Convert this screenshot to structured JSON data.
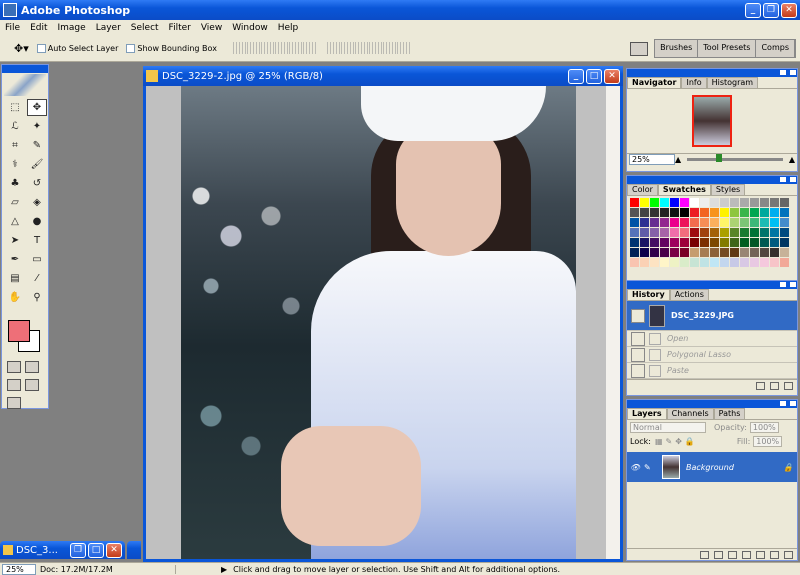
{
  "app": {
    "title": "Adobe Photoshop"
  },
  "menu": [
    "File",
    "Edit",
    "Image",
    "Layer",
    "Select",
    "Filter",
    "View",
    "Window",
    "Help"
  ],
  "options": {
    "auto_select": "Auto Select Layer",
    "bounding_box": "Show Bounding Box"
  },
  "wells": [
    "Brushes",
    "Tool Presets",
    "Comps"
  ],
  "document": {
    "title": "DSC_3229-2.jpg @ 25% (RGB/8)"
  },
  "navigator": {
    "tabs": [
      "Navigator",
      "Info",
      "Histogram"
    ],
    "zoom": "25%"
  },
  "color_panel": {
    "tabs": [
      "Color",
      "Swatches",
      "Styles"
    ]
  },
  "history": {
    "tabs": [
      "History",
      "Actions"
    ],
    "snapshot": "DSC_3229.JPG",
    "states": [
      "Open",
      "Polygonal Lasso",
      "Paste"
    ]
  },
  "layers": {
    "tabs": [
      "Layers",
      "Channels",
      "Paths"
    ],
    "blend": "Normal",
    "opacity_label": "Opacity:",
    "opacity": "100%",
    "lock_label": "Lock:",
    "fill_label": "Fill:",
    "fill": "100%",
    "layer_name": "Background"
  },
  "minimized": {
    "title": "DSC_3..."
  },
  "status": {
    "zoom": "25%",
    "doc": "Doc: 17.2M/17.2M",
    "hint": "Click and drag to move layer or selection.  Use Shift and Alt for additional options."
  },
  "colors": {
    "title_blue": "#0a56d8",
    "foreground": "#ee6f78",
    "background": "#ffffff",
    "selection": "#316ac5"
  }
}
